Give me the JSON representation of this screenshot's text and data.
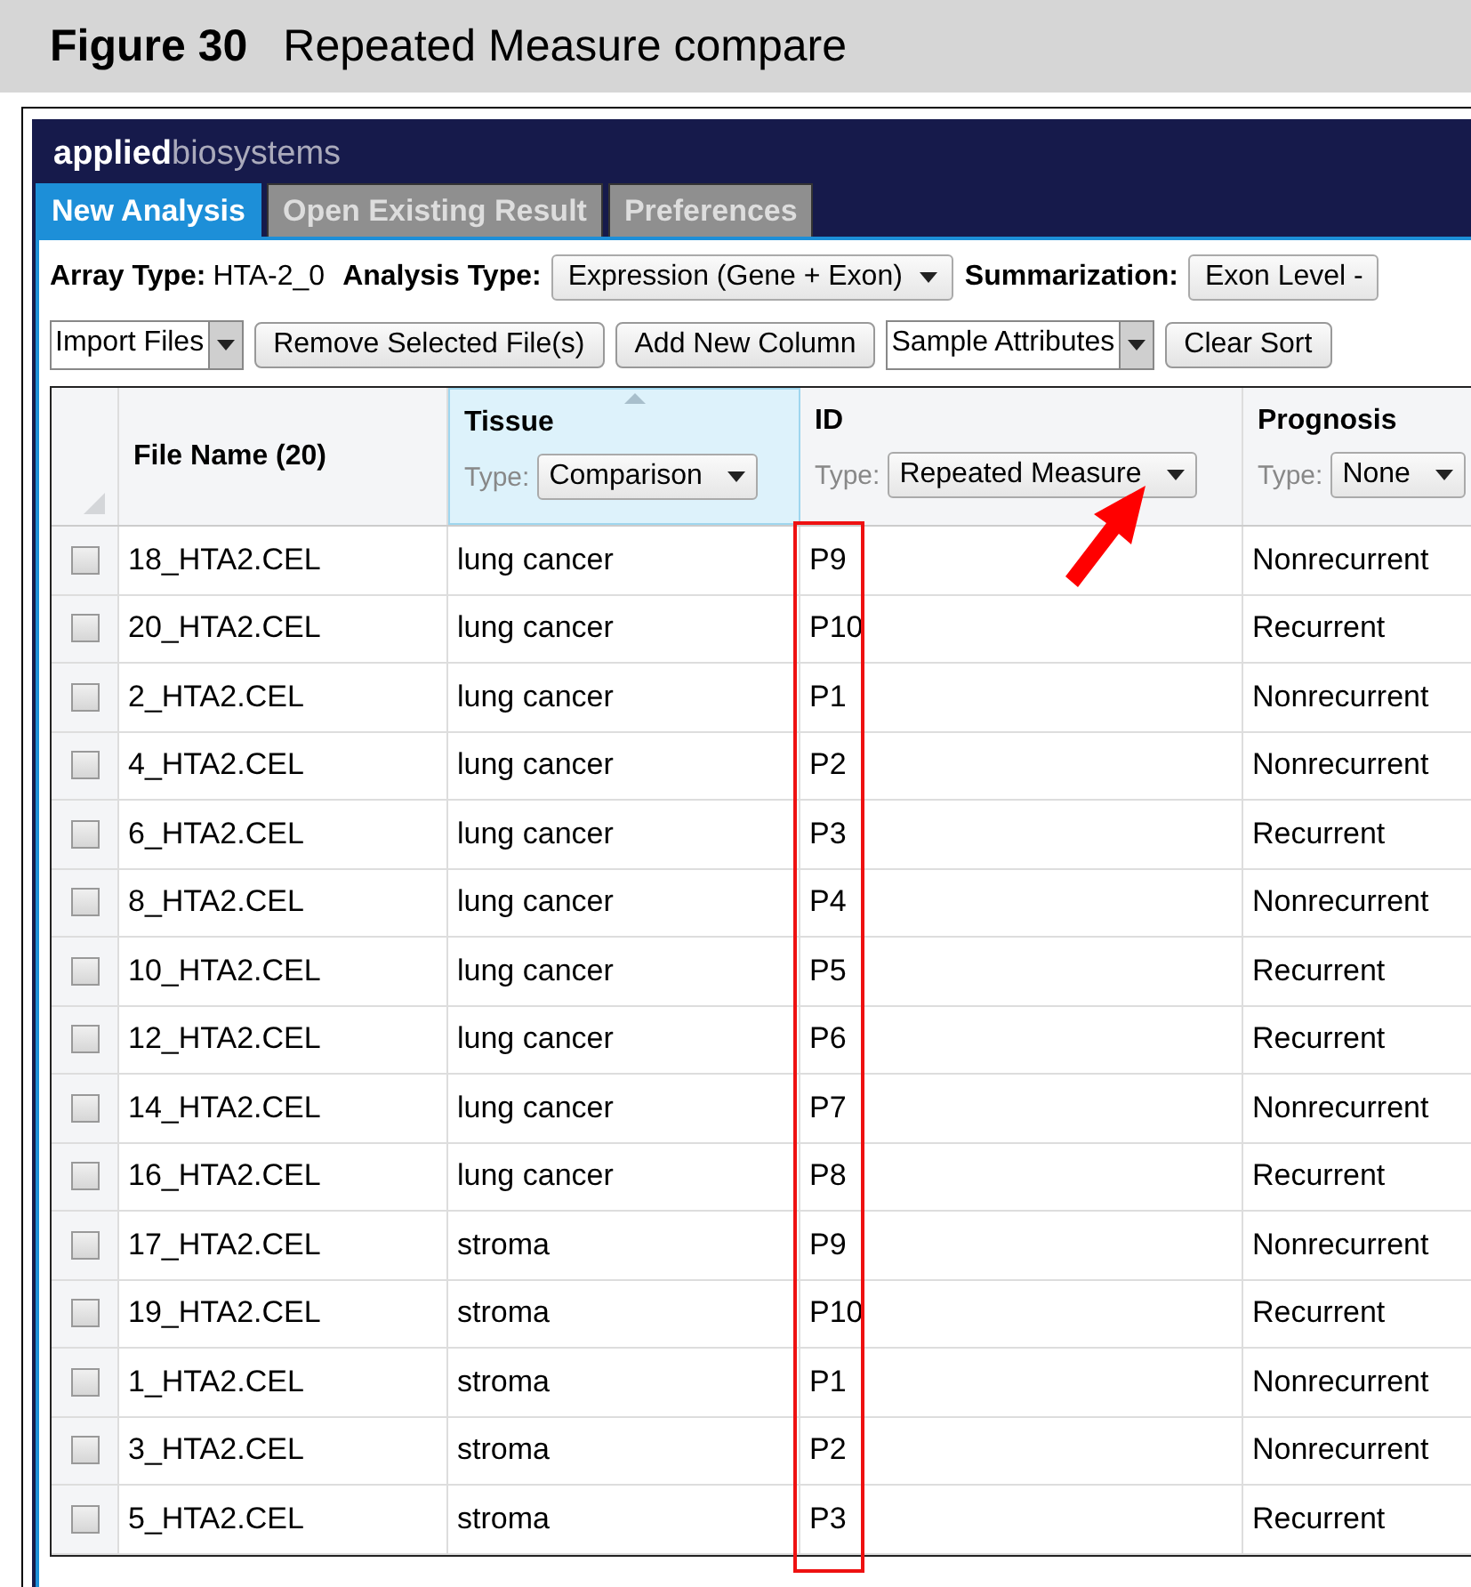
{
  "figure": {
    "label": "Figure 30",
    "caption": "Repeated Measure compare"
  },
  "app": {
    "brand_bold": "applied",
    "brand_light": "biosystems",
    "tabs": [
      {
        "label": "New Analysis",
        "selected": true
      },
      {
        "label": "Open Existing Result",
        "selected": false
      },
      {
        "label": "Preferences",
        "selected": false
      }
    ],
    "settings": [
      {
        "kind": "text",
        "label": "Array Type:",
        "value": "HTA-2_0"
      },
      {
        "kind": "dropdown",
        "label": "Analysis Type:",
        "value": "Expression (Gene + Exon)"
      },
      {
        "kind": "dropdown",
        "label": "Summarization:",
        "value": "Exon Level -"
      }
    ],
    "actions": [
      {
        "kind": "split",
        "label": "Import Files"
      },
      {
        "kind": "button",
        "label": "Remove Selected File(s)"
      },
      {
        "kind": "button",
        "label": "Add New Column"
      },
      {
        "kind": "split",
        "label": "Sample Attributes"
      },
      {
        "kind": "button",
        "label": "Clear Sort"
      }
    ],
    "table": {
      "columns": [
        {
          "title": "File Name (20)",
          "sorted": false,
          "annotated": false
        },
        {
          "title": "Tissue",
          "type_label": "Type:",
          "type_value": "Comparison",
          "sorted": true,
          "annotated": false
        },
        {
          "title": "ID",
          "type_label": "Type:",
          "type_value": "Repeated Measure",
          "sorted": false,
          "annotated": true
        },
        {
          "title": "Prognosis",
          "type_label": "Type:",
          "type_value": "None",
          "sorted": false,
          "annotated": false
        }
      ],
      "rows": [
        {
          "checked": false,
          "cells": [
            "18_HTA2.CEL",
            "lung cancer",
            "P9",
            "Nonrecurrent"
          ]
        },
        {
          "checked": false,
          "cells": [
            "20_HTA2.CEL",
            "lung cancer",
            "P10",
            "Recurrent"
          ]
        },
        {
          "checked": false,
          "cells": [
            "2_HTA2.CEL",
            "lung cancer",
            "P1",
            "Nonrecurrent"
          ]
        },
        {
          "checked": false,
          "cells": [
            "4_HTA2.CEL",
            "lung cancer",
            "P2",
            "Nonrecurrent"
          ]
        },
        {
          "checked": false,
          "cells": [
            "6_HTA2.CEL",
            "lung cancer",
            "P3",
            "Recurrent"
          ]
        },
        {
          "checked": false,
          "cells": [
            "8_HTA2.CEL",
            "lung cancer",
            "P4",
            "Nonrecurrent"
          ]
        },
        {
          "checked": false,
          "cells": [
            "10_HTA2.CEL",
            "lung cancer",
            "P5",
            "Recurrent"
          ]
        },
        {
          "checked": false,
          "cells": [
            "12_HTA2.CEL",
            "lung cancer",
            "P6",
            "Recurrent"
          ]
        },
        {
          "checked": false,
          "cells": [
            "14_HTA2.CEL",
            "lung cancer",
            "P7",
            "Nonrecurrent"
          ]
        },
        {
          "checked": false,
          "cells": [
            "16_HTA2.CEL",
            "lung cancer",
            "P8",
            "Recurrent"
          ]
        },
        {
          "checked": false,
          "cells": [
            "17_HTA2.CEL",
            "stroma",
            "P9",
            "Nonrecurrent"
          ]
        },
        {
          "checked": false,
          "cells": [
            "19_HTA2.CEL",
            "stroma",
            "P10",
            "Recurrent"
          ]
        },
        {
          "checked": false,
          "cells": [
            "1_HTA2.CEL",
            "stroma",
            "P1",
            "Nonrecurrent"
          ]
        },
        {
          "checked": false,
          "cells": [
            "3_HTA2.CEL",
            "stroma",
            "P2",
            "Nonrecurrent"
          ]
        },
        {
          "checked": false,
          "cells": [
            "5_HTA2.CEL",
            "stroma",
            "P3",
            "Recurrent"
          ]
        }
      ]
    }
  }
}
